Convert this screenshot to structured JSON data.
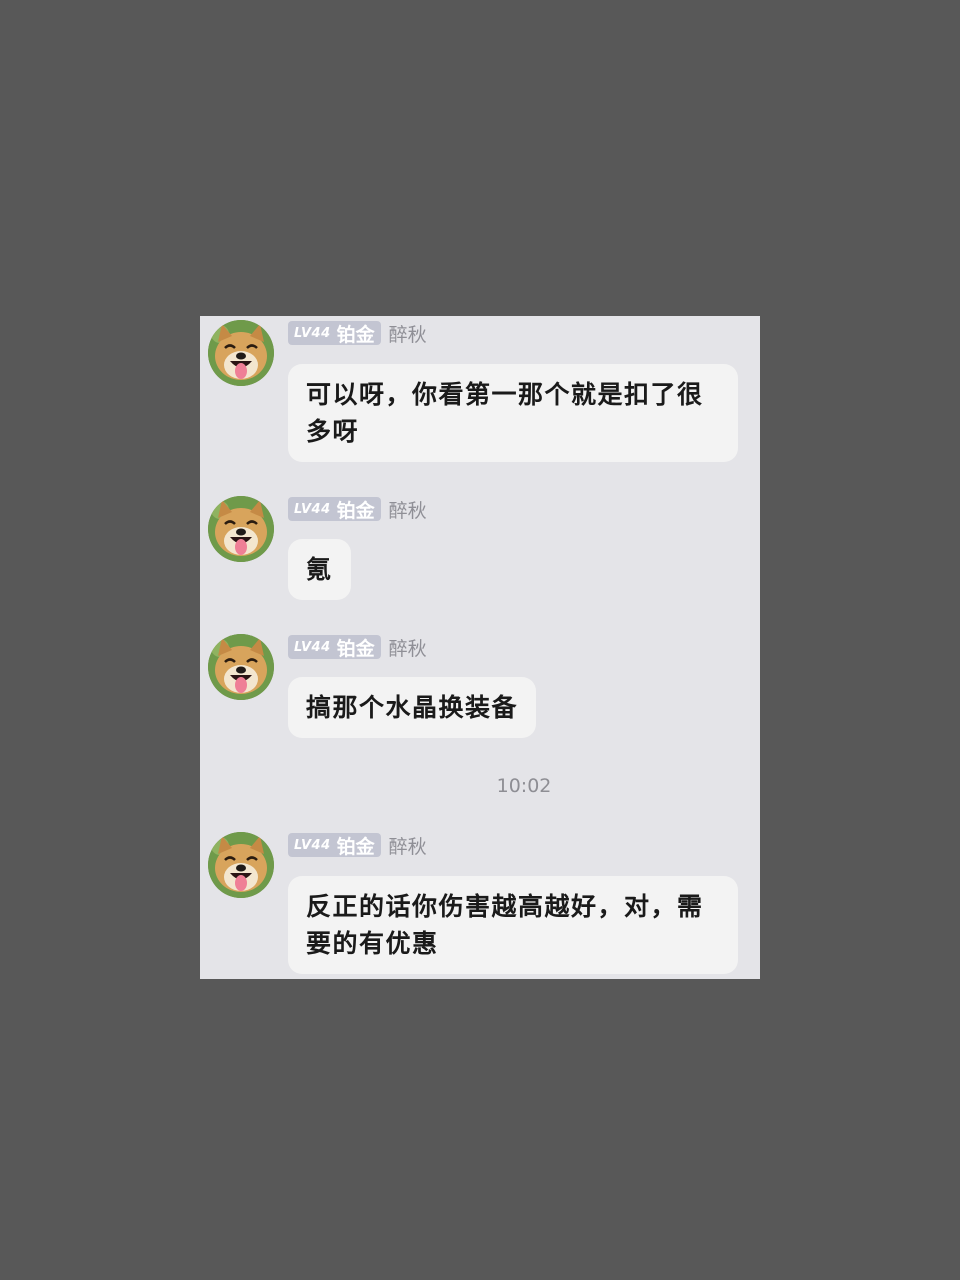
{
  "messages": [
    {
      "level": "LV44",
      "rank": "铂金",
      "sender": "醉秋",
      "text": "可以呀，你看第一那个就是扣了很多呀"
    },
    {
      "level": "LV44",
      "rank": "铂金",
      "sender": "醉秋",
      "text": "氪"
    },
    {
      "level": "LV44",
      "rank": "铂金",
      "sender": "醉秋",
      "text": "搞那个水晶换装备"
    },
    {
      "level": "LV44",
      "rank": "铂金",
      "sender": "醉秋",
      "text": "反正的话你伤害越高越好，对，需要的有优惠"
    }
  ],
  "timestamp": "10:02",
  "colors": {
    "background": "#585858",
    "chat_background": "#e4e4e8",
    "bubble": "#f3f3f3",
    "badge": "#c3c5d2",
    "sender_name": "#8f8f96"
  },
  "icons": {
    "avatar": "shiba-dog-avatar"
  }
}
